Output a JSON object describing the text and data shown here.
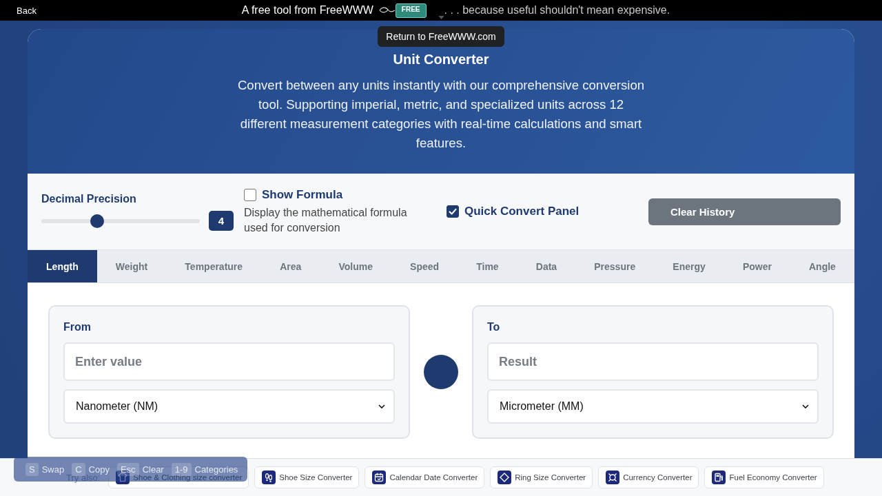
{
  "top_bar": {
    "back": "Back",
    "tagline": "A free tool from FreeWWW",
    "tag_label": "FREE",
    "slogan": ". . . because useful shouldn't mean expensive."
  },
  "tooltip": "Return to FreeWWW.com",
  "header": {
    "title": "Unit Converter",
    "description": "Convert between any units instantly with our comprehensive conversion tool. Supporting imperial, metric, and specialized units across 12 different measurement categories with real-time calculations and smart features."
  },
  "settings": {
    "precision": {
      "label": "Decimal Precision",
      "level": 0.35,
      "value": "4"
    },
    "toggles": [
      {
        "label": "Show Formula",
        "checked": false,
        "description": "Display the mathematical formula used for conversion"
      },
      {
        "label": "Quick Convert Panel",
        "checked": true
      }
    ],
    "clear_button": "Clear History"
  },
  "tabs": [
    {
      "label": "Length",
      "selected": true
    },
    {
      "label": "Weight",
      "selected": false
    },
    {
      "label": "Temperature",
      "selected": false
    },
    {
      "label": "Area",
      "selected": false
    },
    {
      "label": "Volume",
      "selected": false
    },
    {
      "label": "Speed",
      "selected": false
    },
    {
      "label": "Time",
      "selected": false
    },
    {
      "label": "Data",
      "selected": false
    },
    {
      "label": "Pressure",
      "selected": false
    },
    {
      "label": "Energy",
      "selected": false
    },
    {
      "label": "Power",
      "selected": false
    },
    {
      "label": "Angle",
      "selected": false
    }
  ],
  "converter": {
    "from": {
      "label": "From",
      "placeholder": "Enter value",
      "unit": "Nanometer (NM)"
    },
    "to": {
      "label": "To",
      "placeholder": "Result",
      "unit": "Micrometer (MM)"
    }
  },
  "try_also": {
    "label": "Try also:",
    "links": [
      {
        "label": "Shoe & Clothing size converter"
      },
      {
        "label": "Shoe Size Converter"
      },
      {
        "label": "Calendar Date Converter"
      },
      {
        "label": "Ring Size Converter"
      },
      {
        "label": "Currency Converter"
      },
      {
        "label": "Fuel Economy Converter"
      }
    ]
  },
  "shortcuts": [
    {
      "key": "S",
      "label": "Swap"
    },
    {
      "key": "C",
      "label": "Copy"
    },
    {
      "key": "Esc",
      "label": "Clear"
    },
    {
      "key": "1-9",
      "label": "Categories"
    }
  ]
}
